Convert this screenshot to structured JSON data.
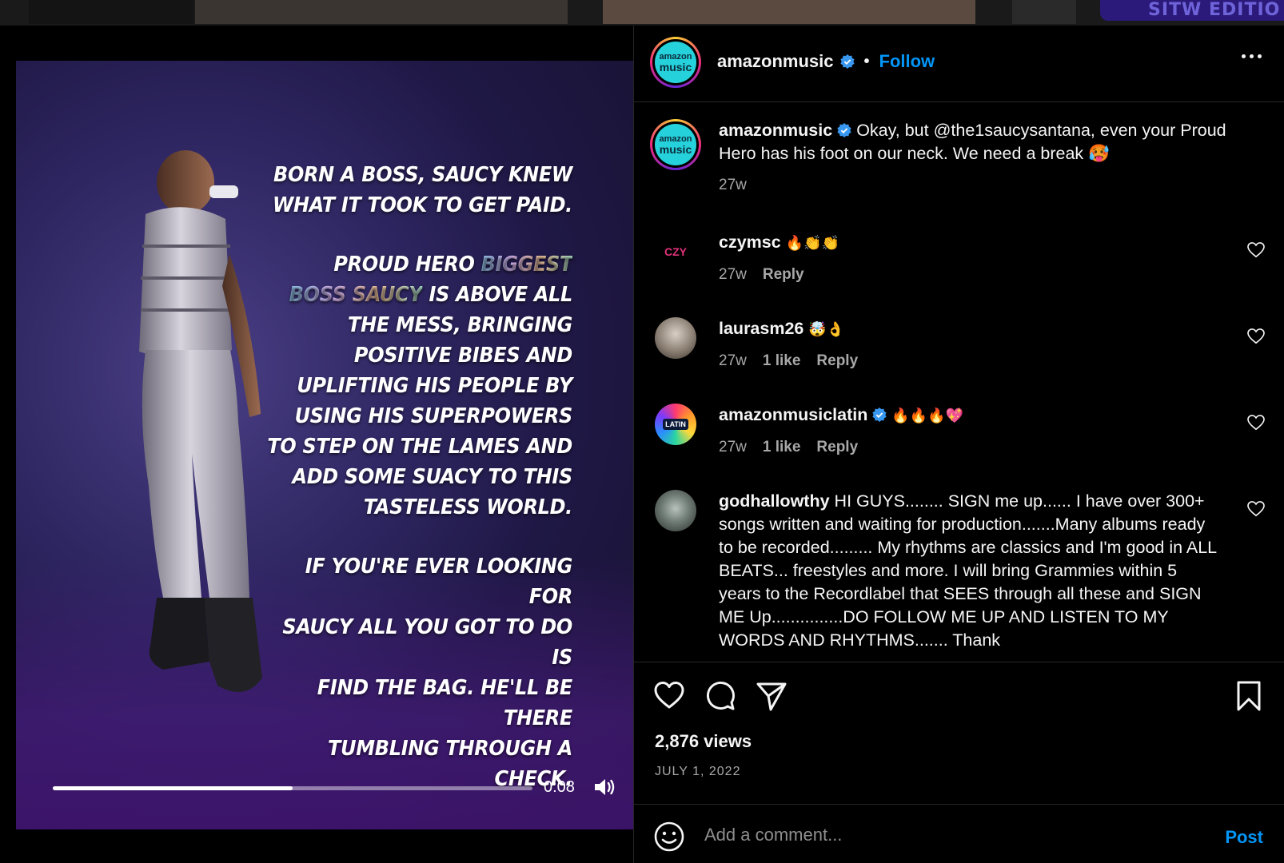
{
  "background": {
    "badge_text": "SITW EDITIO"
  },
  "video": {
    "poster_lines": {
      "p1": [
        "BORN A BOSS, SAUCY KNEW",
        "WHAT IT TOOK TO GET PAID."
      ],
      "p2_pre": "PROUD HERO ",
      "p2_hl1": "BIGGEST",
      "p2_hl2": "BOSS SAUCY",
      "p2_post": " IS ABOVE ALL",
      "p2_rest": [
        "THE MESS, BRINGING",
        "POSITIVE BIBES AND",
        "UPLIFTING HIS PEOPLE BY",
        "USING HIS SUPERPOWERS",
        "TO STEP ON THE LAMES AND",
        "ADD SOME SUACY TO THIS",
        "TASTELESS WORLD."
      ],
      "p3": [
        "IF YOU'RE EVER LOOKING FOR",
        "SAUCY ALL YOU GOT TO DO IS",
        "FIND THE BAG. HE'LL BE THERE",
        "TUMBLING THROUGH A CHECK."
      ]
    },
    "progress": 0.5,
    "time": "0:08",
    "volume_icon": "volume-icon"
  },
  "header": {
    "username": "amazonmusic",
    "follow_label": "Follow",
    "avatar_text_top": "amazon",
    "avatar_text_bottom": "music"
  },
  "caption": {
    "username": "amazonmusic",
    "text": "Okay, but @the1saucysantana, even your Proud Hero has his foot on our neck. We need a break 🥵",
    "time": "27w"
  },
  "comments": [
    {
      "username": "czymsc",
      "text": "🔥👏👏",
      "time": "27w",
      "likes": "",
      "reply": "Reply",
      "avatar_text": "CZY"
    },
    {
      "username": "laurasm26",
      "text": "🤯👌",
      "time": "27w",
      "likes": "1 like",
      "reply": "Reply"
    },
    {
      "username": "amazonmusiclatin",
      "text": "🔥🔥🔥💖",
      "time": "27w",
      "likes": "1 like",
      "reply": "Reply",
      "avatar_text": "LATIN"
    },
    {
      "username": "godhallowthy",
      "text": "HI GUYS........ SIGN me up...... I have over 300+ songs written and waiting for production.......Many albums ready to be recorded......... My rhythms are classics and I'm good in ALL BEATS... freestyles and more. I will bring Grammies within 5 years to the Recordlabel that SEES through all these and SIGN ME Up...............DO FOLLOW ME UP AND LISTEN TO MY WORDS AND RHYTHMS....... Thank"
    }
  ],
  "actions": {
    "views": "2,876 views",
    "date": "JULY 1, 2022"
  },
  "add_comment": {
    "placeholder": "Add a comment...",
    "post_label": "Post"
  },
  "colors": {
    "accent": "#0095f6",
    "background": "#000000",
    "secondary_text": "#a8a8a8"
  }
}
